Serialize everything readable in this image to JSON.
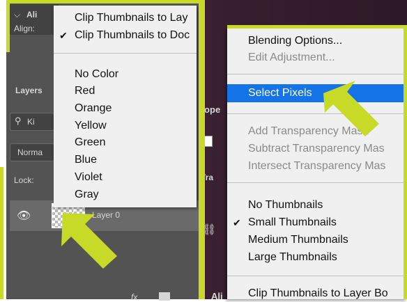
{
  "left_panel": {
    "align_header": "Ali",
    "align_label": "Align:",
    "layers_tab": "Layers",
    "search_placeholder": "Ki",
    "blend_mode": "Norma",
    "lock_label": "Lock:",
    "layer_name": "Layer 0",
    "props_tab_partial": "rope",
    "tra_partial": "Tra",
    "bottom_align": "Ali",
    "bottom_fx": "fx"
  },
  "left_menu": {
    "items": [
      {
        "label": "Clip Thumbnails to Lay",
        "checked": false
      },
      {
        "label": "Clip Thumbnails to Doc",
        "checked": true
      }
    ],
    "colors": [
      "No Color",
      "Red",
      "Orange",
      "Yellow",
      "Green",
      "Blue",
      "Violet",
      "Gray"
    ]
  },
  "right_menu": {
    "group1": [
      "Blending Options...",
      "Edit Adjustment..."
    ],
    "selected": "Select Pixels",
    "group2": [
      "Add Transparency Mask",
      "Subtract Transparency Mas",
      "Intersect Transparency Mas"
    ],
    "thumbnails": [
      {
        "label": "No Thumbnails",
        "checked": false
      },
      {
        "label": "Small Thumbnails",
        "checked": true
      },
      {
        "label": "Medium Thumbnails",
        "checked": false
      },
      {
        "label": "Large Thumbnails",
        "checked": false
      }
    ],
    "bottom": "Clip Thumbnails to Layer Bo"
  },
  "colors": {
    "accent_border": "#c8da28",
    "highlight": "#1473e6",
    "ps_dark": "#535353"
  },
  "check_glyph": "✔"
}
